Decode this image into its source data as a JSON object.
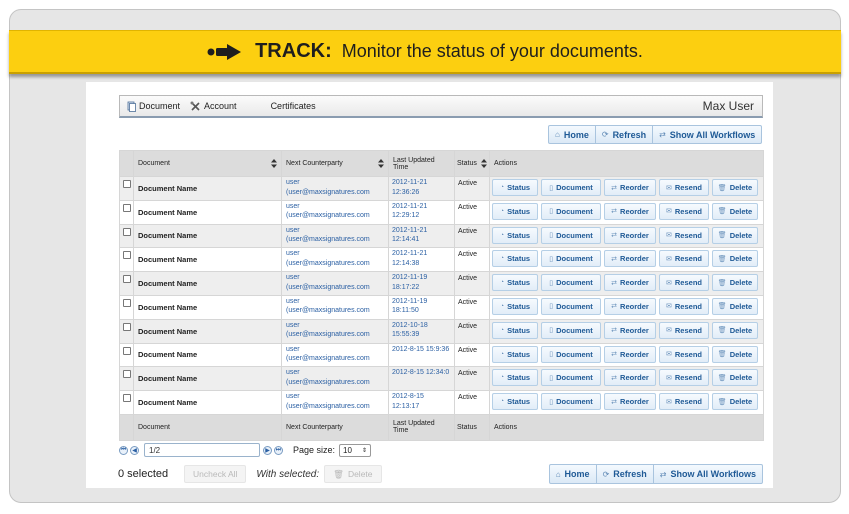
{
  "banner": {
    "keyword": "TRACK:",
    "text": "Monitor the status of your documents.",
    "color": "#fccf10"
  },
  "appbar": {
    "menus": [
      {
        "label": "Document",
        "icon": "document-icon"
      },
      {
        "label": "Account",
        "icon": "tools-icon"
      },
      {
        "label": "Certificates",
        "icon": ""
      }
    ],
    "user": "Max User"
  },
  "toolbar": {
    "home": "Home",
    "refresh": "Refresh",
    "show_all": "Show All Workflows"
  },
  "table": {
    "headers": {
      "document": "Document",
      "counterparty": "Next Counterparty",
      "updated": "Last Updated Time",
      "status": "Status",
      "actions": "Actions"
    },
    "footer": {
      "document": "Document",
      "counterparty": "Next Counterparty",
      "updated": "Last Updated Time",
      "status": "Status",
      "actions": "Actions"
    },
    "action_labels": [
      "Status",
      "Document",
      "Reorder",
      "Resend",
      "Delete"
    ],
    "rows": [
      {
        "name": "Document Name",
        "cp_name": "user",
        "cp_email": "(user@maxsignatures.com",
        "date": "2012-11-21",
        "time": "12:36:26",
        "status": "Active"
      },
      {
        "name": "Document Name",
        "cp_name": "user",
        "cp_email": "(user@maxsignatures.com",
        "date": "2012-11-21",
        "time": "12:29:12",
        "status": "Active"
      },
      {
        "name": "Document Name",
        "cp_name": "user",
        "cp_email": "(user@maxsignatures.com",
        "date": "2012-11-21",
        "time": "12:14:41",
        "status": "Active"
      },
      {
        "name": "Document Name",
        "cp_name": "user",
        "cp_email": "(user@maxsignatures.com",
        "date": "2012-11-21",
        "time": "12:14:38",
        "status": "Active"
      },
      {
        "name": "Document Name",
        "cp_name": "user",
        "cp_email": "(user@maxsignatures.com",
        "date": "2012-11-19",
        "time": "18:17:22",
        "status": "Active"
      },
      {
        "name": "Document Name",
        "cp_name": "user",
        "cp_email": "(user@maxsignatures.com",
        "date": "2012-11-19",
        "time": "18:11:50",
        "status": "Active"
      },
      {
        "name": "Document Name",
        "cp_name": "user",
        "cp_email": "(user@maxsignatures.com",
        "date": "2012-10-18",
        "time": "15:55:39",
        "status": "Active"
      },
      {
        "name": "Document Name",
        "cp_name": "user",
        "cp_email": "(user@maxsignatures.com",
        "date": "2012-8-15 15:9:36",
        "time": "",
        "status": "Active"
      },
      {
        "name": "Document Name",
        "cp_name": "user",
        "cp_email": "(user@maxsignatures.com",
        "date": "2012-8-15 12:34:0",
        "time": "",
        "status": "Active"
      },
      {
        "name": "Document Name",
        "cp_name": "user",
        "cp_email": "(user@maxsignatures.com",
        "date": "2012-8-15",
        "time": "12:13:17",
        "status": "Active"
      }
    ]
  },
  "pager": {
    "page_value": "1/2",
    "page_size_label": "Page size:",
    "page_size_value": "10"
  },
  "bottom": {
    "selected": "0 selected",
    "uncheck_all": "Uncheck All",
    "with_selected": "With selected:",
    "delete": "Delete"
  }
}
